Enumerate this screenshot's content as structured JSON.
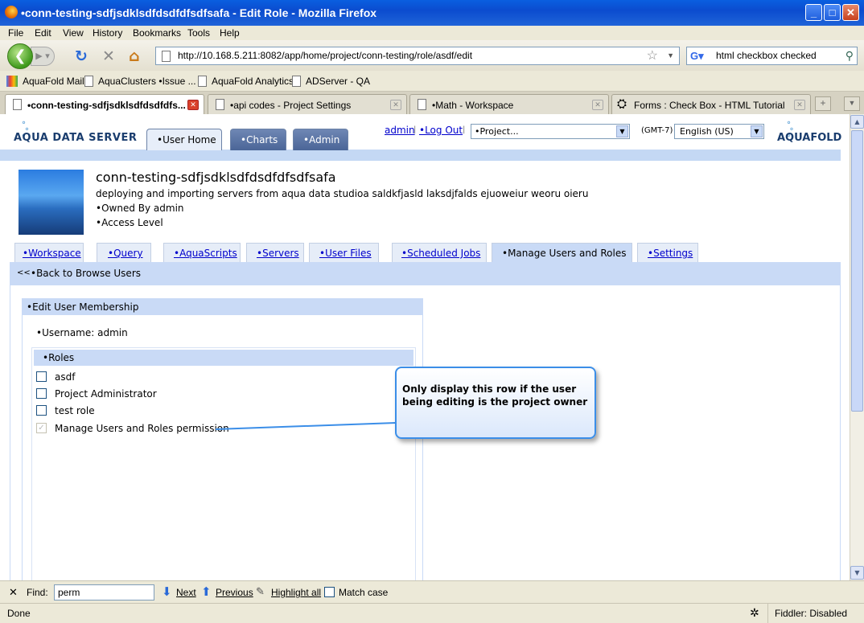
{
  "window": {
    "title": "•conn-testing-sdfjsdklsdfdsdfdfsdfsafa - Edit Role - Mozilla Firefox"
  },
  "menu": [
    "File",
    "Edit",
    "View",
    "History",
    "Bookmarks",
    "Tools",
    "Help"
  ],
  "nav": {
    "url": "http://10.168.5.211:8082/app/home/project/conn-testing/role/asdf/edit",
    "search": "html checkbox checked"
  },
  "bookmarks": [
    "AquaFold Mail",
    "AquaClusters •Issue ...",
    "AquaFold Analytics",
    "ADServer - QA"
  ],
  "browser_tabs": [
    "•conn-testing-sdfjsdklsdfdsdfdfs...",
    "•api codes - Project Settings",
    "•Math - Workspace",
    "Forms : Check Box - HTML Tutorial"
  ],
  "app": {
    "logo": "AQUA DATA SERVER",
    "logo_right": "AQUAFOLD",
    "tabs": [
      "•User Home",
      "•Charts",
      "•Admin"
    ],
    "user": "admin",
    "logout": "•Log Out",
    "sep": "|",
    "project_select": "•Project...",
    "timezone": "(GMT-7)",
    "language": "English (US)"
  },
  "project": {
    "title": "conn-testing-sdfjsdklsdfdsdfdfsdfsafa",
    "description": "deploying and importing servers from aqua data studioa saldkfjasld laksdjfalds ejuoweiur weoru oieru",
    "owner": "•Owned By admin",
    "access": "•Access Level"
  },
  "project_tabs": [
    "•Workspace",
    "•Query",
    "•AquaScripts",
    "•Servers",
    "•User Files",
    "•Scheduled Jobs",
    "•Manage Users and Roles",
    "•Settings"
  ],
  "back_link": "•Back to Browse Users",
  "back_arrows": "<<",
  "panel": {
    "title": "•Edit User Membership",
    "username": "•Username: admin",
    "roles_header": "•Roles",
    "roles": [
      "asdf",
      "Project Administrator",
      "test role",
      "Manage Users and Roles permission"
    ]
  },
  "callout": "Only display this row if the user being editing is the project owner",
  "findbar": {
    "label": "Find:",
    "value": "perm",
    "next": "Next",
    "previous": "Previous",
    "highlight": "Highlight all",
    "match": "Match case"
  },
  "status": {
    "left": "Done",
    "right": "Fiddler: Disabled"
  }
}
